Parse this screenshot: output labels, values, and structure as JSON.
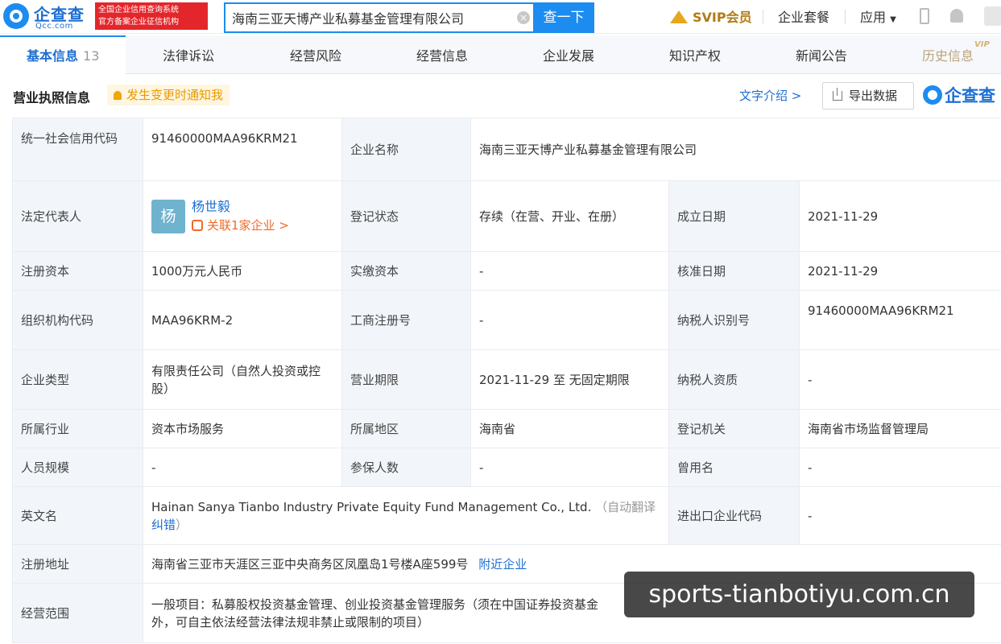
{
  "header": {
    "logo_text": "企查查",
    "logo_sub": "Qcc.com",
    "gov_badge_line1": "全国企业信用查询系统",
    "gov_badge_line2": "官方备案企业征信机构",
    "search_value": "海南三亚天博产业私募基金管理有限公司",
    "search_button": "查一下",
    "svip_label": "SVIP会员",
    "nav_package": "企业套餐",
    "nav_apps": "应用"
  },
  "tabs": [
    {
      "label": "基本信息",
      "count": "13"
    },
    {
      "label": "法律诉讼"
    },
    {
      "label": "经营风险"
    },
    {
      "label": "经营信息"
    },
    {
      "label": "企业发展"
    },
    {
      "label": "知识产权"
    },
    {
      "label": "新闻公告"
    },
    {
      "label": "历史信息",
      "badge": "VIP"
    }
  ],
  "section": {
    "title": "营业执照信息",
    "notify": "发生变更时通知我",
    "text_intro": "文字介绍 >",
    "export": "导出数据",
    "brand": "企查查"
  },
  "info": {
    "credit_code_label": "统一社会信用代码",
    "credit_code": "91460000MAA96KRM21",
    "company_name_label": "企业名称",
    "company_name": "海南三亚天博产业私募基金管理有限公司",
    "legal_rep_label": "法定代表人",
    "legal_rep_avatar": "杨",
    "legal_rep_name": "杨世毅",
    "legal_rep_related": "关联1家企业 >",
    "reg_status_label": "登记状态",
    "reg_status": "存续（在营、开业、在册）",
    "established_label": "成立日期",
    "established": "2021-11-29",
    "reg_capital_label": "注册资本",
    "reg_capital": "1000万元人民币",
    "paid_capital_label": "实缴资本",
    "paid_capital": "-",
    "approved_label": "核准日期",
    "approved": "2021-11-29",
    "org_code_label": "组织机构代码",
    "org_code": "MAA96KRM-2",
    "biz_reg_no_label": "工商注册号",
    "biz_reg_no": "-",
    "taxpayer_id_label": "纳税人识别号",
    "taxpayer_id": "91460000MAA96KRM21",
    "company_type_label": "企业类型",
    "company_type": "有限责任公司（自然人投资或控股）",
    "biz_term_label": "营业期限",
    "biz_term": "2021-11-29 至 无固定期限",
    "taxpayer_qual_label": "纳税人资质",
    "taxpayer_qual": "-",
    "industry_label": "所属行业",
    "industry": "资本市场服务",
    "region_label": "所属地区",
    "region": "海南省",
    "authority_label": "登记机关",
    "authority": "海南省市场监督管理局",
    "staff_size_label": "人员规模",
    "staff_size": "-",
    "insured_label": "参保人数",
    "insured": "-",
    "former_name_label": "曾用名",
    "former_name": "-",
    "english_name_label": "英文名",
    "english_name": "Hainan Sanya Tianbo Industry Private Equity Fund Management Co., Ltd.",
    "english_note": "（自动翻译",
    "english_correct": "纠错",
    "english_close": "）",
    "import_export_label": "进出口企业代码",
    "import_export": "-",
    "address_label": "注册地址",
    "address": "海南省三亚市天涯区三亚中央商务区凤凰岛1号楼A座599号",
    "nearby": "附近企业",
    "scope_label": "经营范围",
    "scope_line1": "一般项目：私募股权投资基金管理、创业投资基金管理服务（须在中国证券投资基金",
    "scope_tail": "外",
    "scope_line2": "外，可自主依法经营法律法规非禁止或限制的项目）"
  },
  "watermark": "sports-tianbotiyu.com.cn",
  "colors": {
    "brand_blue": "#1d8cf0",
    "link_blue": "#1d6fd1",
    "label_bg": "#f2f6fb",
    "notify_orange": "#e89a00",
    "related_orange": "#f06b2a",
    "gov_red": "#e3262b"
  }
}
